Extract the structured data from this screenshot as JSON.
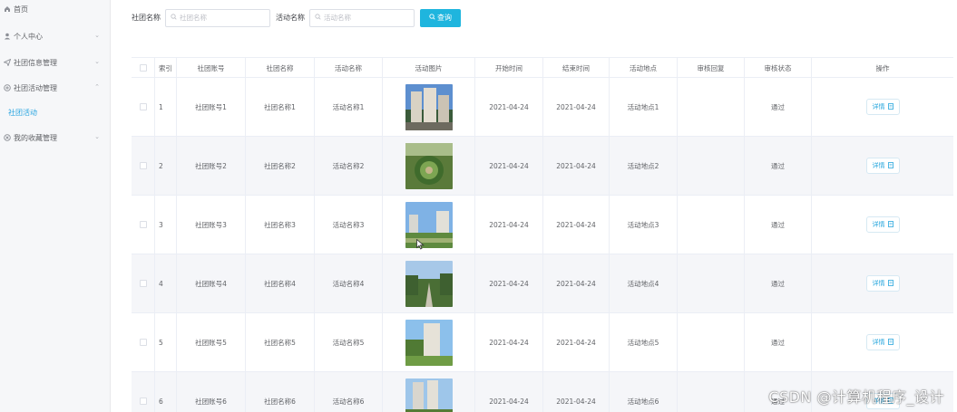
{
  "sidebar": {
    "home": "首页",
    "personal": "个人中心",
    "club_info": "社团信息管理",
    "club_activity": "社团活动管理",
    "club_activity_sub": "社团活动",
    "favorites": "我的收藏管理"
  },
  "search": {
    "club_name_label": "社团名称",
    "club_name_placeholder": "社团名称",
    "activity_name_label": "活动名称",
    "activity_name_placeholder": "活动名称",
    "query_button": "查询"
  },
  "table": {
    "headers": [
      "索引",
      "社团账号",
      "社团名称",
      "活动名称",
      "活动图片",
      "开始时间",
      "结束时间",
      "活动地点",
      "审核回复",
      "审核状态",
      "操作"
    ],
    "detail_label": "详情",
    "rows": [
      {
        "index": "1",
        "account": "社团账号1",
        "club": "社团名称1",
        "activity": "活动名称1",
        "start": "2021-04-24",
        "end": "2021-04-24",
        "place": "活动地点1",
        "reply": "",
        "status": "通过"
      },
      {
        "index": "2",
        "account": "社团账号2",
        "club": "社团名称2",
        "activity": "活动名称2",
        "start": "2021-04-24",
        "end": "2021-04-24",
        "place": "活动地点2",
        "reply": "",
        "status": "通过"
      },
      {
        "index": "3",
        "account": "社团账号3",
        "club": "社团名称3",
        "activity": "活动名称3",
        "start": "2021-04-24",
        "end": "2021-04-24",
        "place": "活动地点3",
        "reply": "",
        "status": "通过"
      },
      {
        "index": "4",
        "account": "社团账号4",
        "club": "社团名称4",
        "activity": "活动名称4",
        "start": "2021-04-24",
        "end": "2021-04-24",
        "place": "活动地点4",
        "reply": "",
        "status": "通过"
      },
      {
        "index": "5",
        "account": "社团账号5",
        "club": "社团名称5",
        "activity": "活动名称5",
        "start": "2021-04-24",
        "end": "2021-04-24",
        "place": "活动地点5",
        "reply": "",
        "status": "通过"
      },
      {
        "index": "6",
        "account": "社团账号6",
        "club": "社团名称6",
        "activity": "活动名称6",
        "start": "2021-04-24",
        "end": "2021-04-24",
        "place": "活动地点6",
        "reply": "",
        "status": "通过"
      }
    ]
  },
  "watermark": "CSDN @计算机程序_设计",
  "colors": {
    "accent": "#1fb5de",
    "link": "#26a6dd",
    "sidebar_bg": "#f6f7f9",
    "row_alt": "#f5f6f9"
  }
}
